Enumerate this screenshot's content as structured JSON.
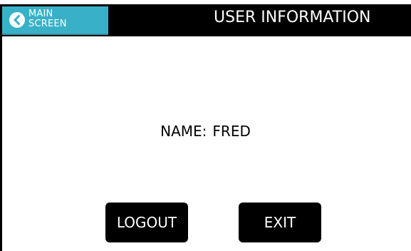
{
  "header": {
    "back_button": {
      "line1": "MAIN",
      "line2": "SCREEN",
      "icon": "chevron-left-circle-icon",
      "color": "#38b1c8"
    },
    "title": "USER INFORMATION"
  },
  "main": {
    "name_label": "NAME:",
    "name_value": "FRED"
  },
  "buttons": {
    "logout": "LOGOUT",
    "exit": "EXIT"
  }
}
